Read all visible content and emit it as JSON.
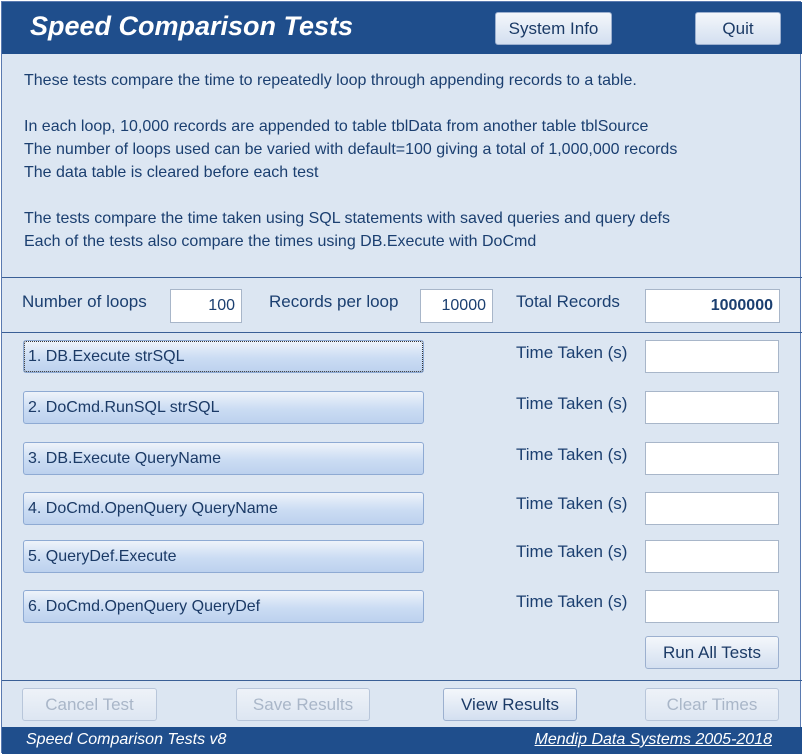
{
  "header": {
    "title": "Speed Comparison Tests",
    "system_info_label": "System Info",
    "quit_label": "Quit"
  },
  "intro": {
    "line1": "These tests compare the time to repeatedly loop through appending records to a table.",
    "line2": "In each loop, 10,000 records are appended to table tblData from another table tblSource",
    "line3": "The number of loops used can be varied with default=100 giving a total of 1,000,000 records",
    "line4": "The data table is cleared before each test",
    "line5": "The tests compare the time taken using SQL statements with saved queries and query defs",
    "line6": "Each of the tests also compare the times using DB.Execute with DoCmd"
  },
  "params": {
    "loops_label": "Number of loops",
    "loops_value": "100",
    "records_label": "Records per loop",
    "records_value": "10000",
    "total_label": "Total Records",
    "total_value": "1000000"
  },
  "tests": [
    {
      "label": "1.  DB.Execute strSQL",
      "time_label": "Time Taken (s)",
      "time_value": ""
    },
    {
      "label": "2.  DoCmd.RunSQL strSQL",
      "time_label": "Time Taken (s)",
      "time_value": ""
    },
    {
      "label": "3.  DB.Execute QueryName",
      "time_label": "Time Taken (s)",
      "time_value": ""
    },
    {
      "label": "4.  DoCmd.OpenQuery QueryName",
      "time_label": "Time Taken (s)",
      "time_value": ""
    },
    {
      "label": "5.  QueryDef.Execute",
      "time_label": "Time Taken (s)",
      "time_value": ""
    },
    {
      "label": "6.  DoCmd.OpenQuery  QueryDef",
      "time_label": "Time Taken (s)",
      "time_value": ""
    }
  ],
  "run_all_label": "Run All Tests",
  "bottom_buttons": {
    "cancel": "Cancel Test",
    "save": "Save Results",
    "view": "View Results",
    "clear": "Clear Times"
  },
  "footer": {
    "left": "Speed Comparison Tests v8",
    "right": "Mendip Data Systems 2005-2018"
  },
  "colors": {
    "header_bg": "#1f4e8c",
    "form_bg": "#dce6f2",
    "text": "#1b3f70"
  }
}
